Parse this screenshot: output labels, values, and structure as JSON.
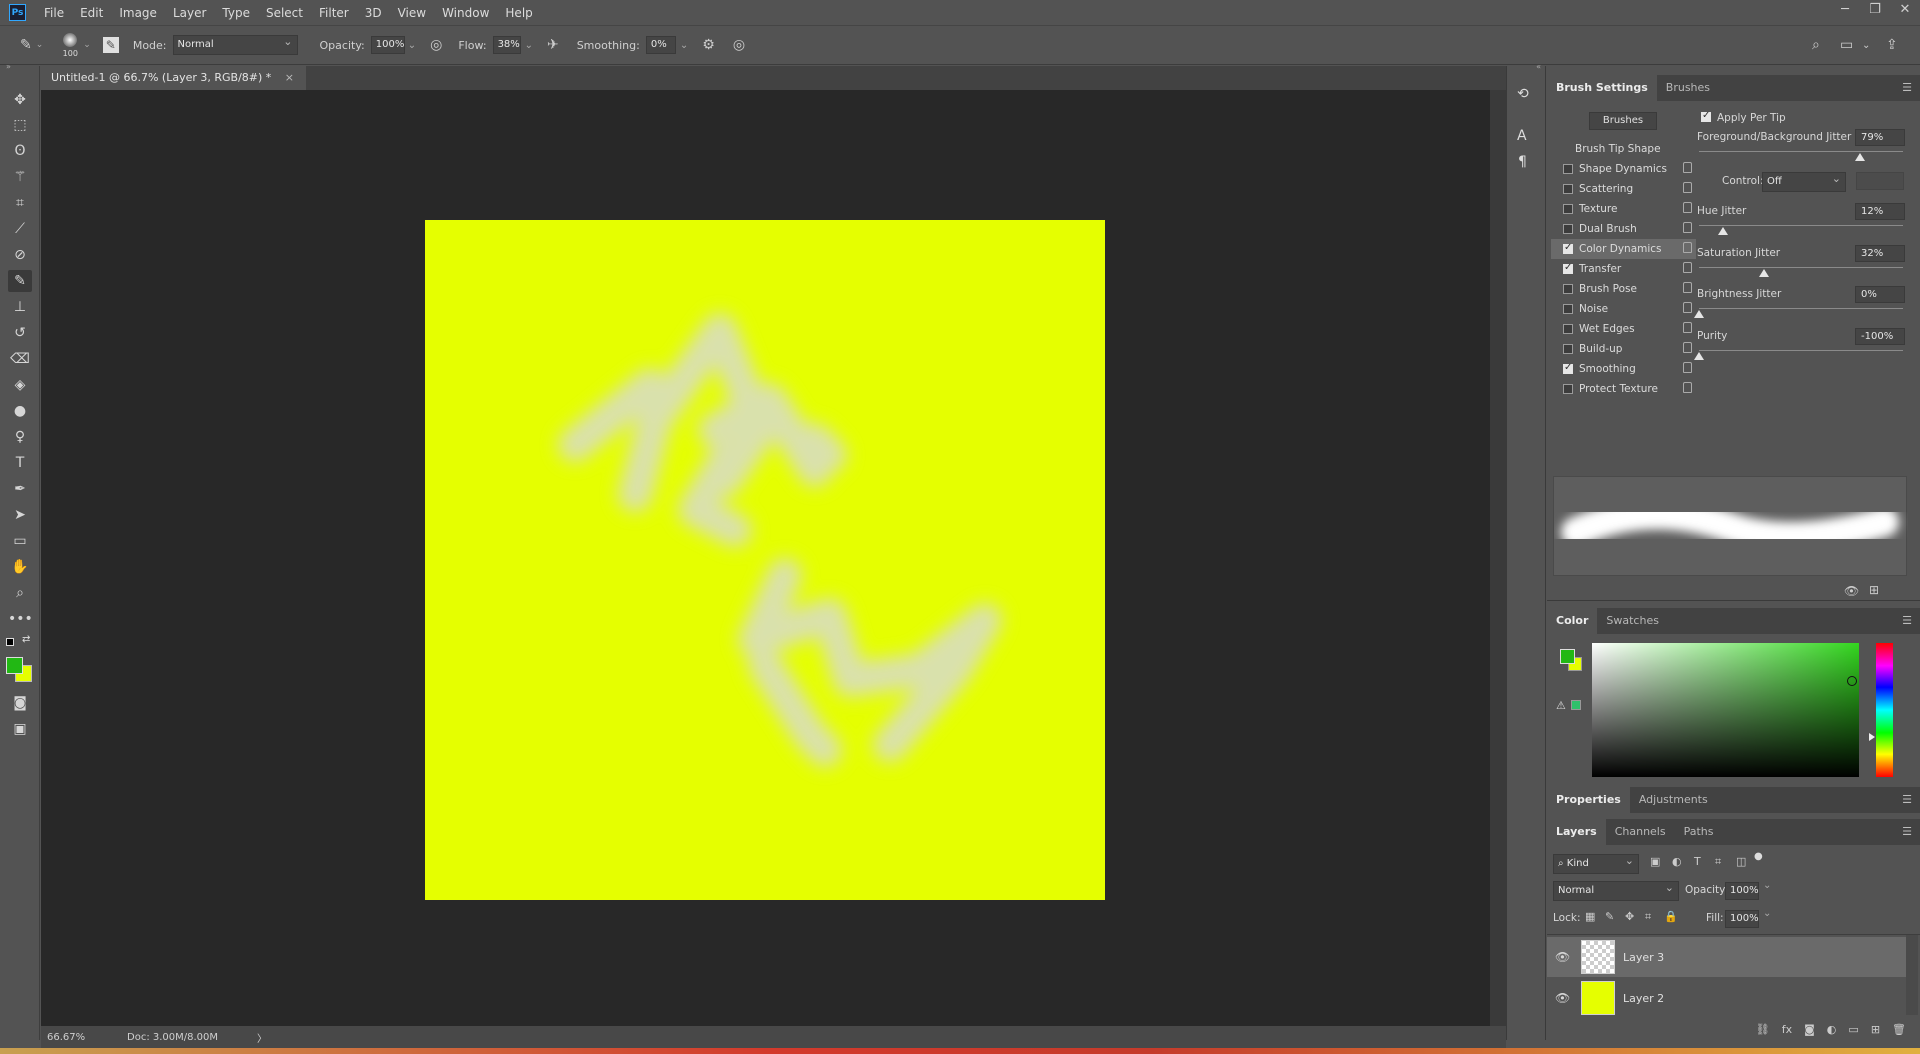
{
  "menu": [
    "File",
    "Edit",
    "Image",
    "Layer",
    "Type",
    "Select",
    "Filter",
    "3D",
    "View",
    "Window",
    "Help"
  ],
  "app_logo": "Ps",
  "window_controls": {
    "minimize": "─",
    "restore": "❐",
    "close": "✕"
  },
  "options": {
    "brush_size": "100",
    "mode_label": "Mode:",
    "mode_value": "Normal",
    "opacity_label": "Opacity:",
    "opacity_value": "100%",
    "flow_label": "Flow:",
    "flow_value": "38%",
    "smoothing_label": "Smoothing:",
    "smoothing_value": "0%"
  },
  "document": {
    "tab_title": "Untitled-1 @ 66.7% (Layer 3, RGB/8#) *",
    "close": "×",
    "background_color": "#e5ff00",
    "stroke_color": "#d8dccb"
  },
  "status": {
    "zoom": "66.67%",
    "doc": "Doc: 3.00M/8.00M",
    "arrow": "〉"
  },
  "brush_panel": {
    "tabs": [
      "Brush Settings",
      "Brushes"
    ],
    "brushes_button": "Brushes",
    "tip_shape": "Brush Tip Shape",
    "options": [
      {
        "label": "Shape Dynamics",
        "checked": false
      },
      {
        "label": "Scattering",
        "checked": false
      },
      {
        "label": "Texture",
        "checked": false
      },
      {
        "label": "Dual Brush",
        "checked": false
      },
      {
        "label": "Color Dynamics",
        "checked": true,
        "selected": true
      },
      {
        "label": "Transfer",
        "checked": true
      },
      {
        "label": "Brush Pose",
        "checked": false
      },
      {
        "label": "Noise",
        "checked": false
      },
      {
        "label": "Wet Edges",
        "checked": false
      },
      {
        "label": "Build-up",
        "checked": false
      },
      {
        "label": "Smoothing",
        "checked": true
      },
      {
        "label": "Protect Texture",
        "checked": false
      }
    ],
    "apply_per_tip": "Apply Per Tip",
    "fg_bg_jitter": {
      "label": "Foreground/Background Jitter",
      "value": "79%",
      "level": 0.79
    },
    "control_label": "Control:",
    "control_value": "Off",
    "hue_jitter": {
      "label": "Hue Jitter",
      "value": "12%",
      "level": 0.12
    },
    "saturation_jitter": {
      "label": "Saturation Jitter",
      "value": "32%",
      "level": 0.32
    },
    "brightness_jitter": {
      "label": "Brightness Jitter",
      "value": "0%",
      "level": 0.0
    },
    "purity": {
      "label": "Purity",
      "value": "-100%",
      "level": 0.0
    }
  },
  "color_panel": {
    "tabs": [
      "Color",
      "Swatches"
    ],
    "foreground": "#22b814",
    "background": "#e5ff00",
    "picker_hue": "#33d61f",
    "web_safe": "#2fc16b"
  },
  "properties_tabs": [
    "Properties",
    "Adjustments"
  ],
  "layers_panel": {
    "tabs": [
      "Layers",
      "Channels",
      "Paths"
    ],
    "filter_kind": "Kind",
    "blend_mode": "Normal",
    "opacity_label": "Opacity:",
    "opacity_value": "100%",
    "lock_label": "Lock:",
    "fill_label": "Fill:",
    "fill_value": "100%",
    "layers": [
      {
        "name": "Layer 3",
        "selected": true,
        "thumb": "transparent"
      },
      {
        "name": "Layer 2",
        "selected": false,
        "thumb": "#e5ff00"
      }
    ]
  }
}
